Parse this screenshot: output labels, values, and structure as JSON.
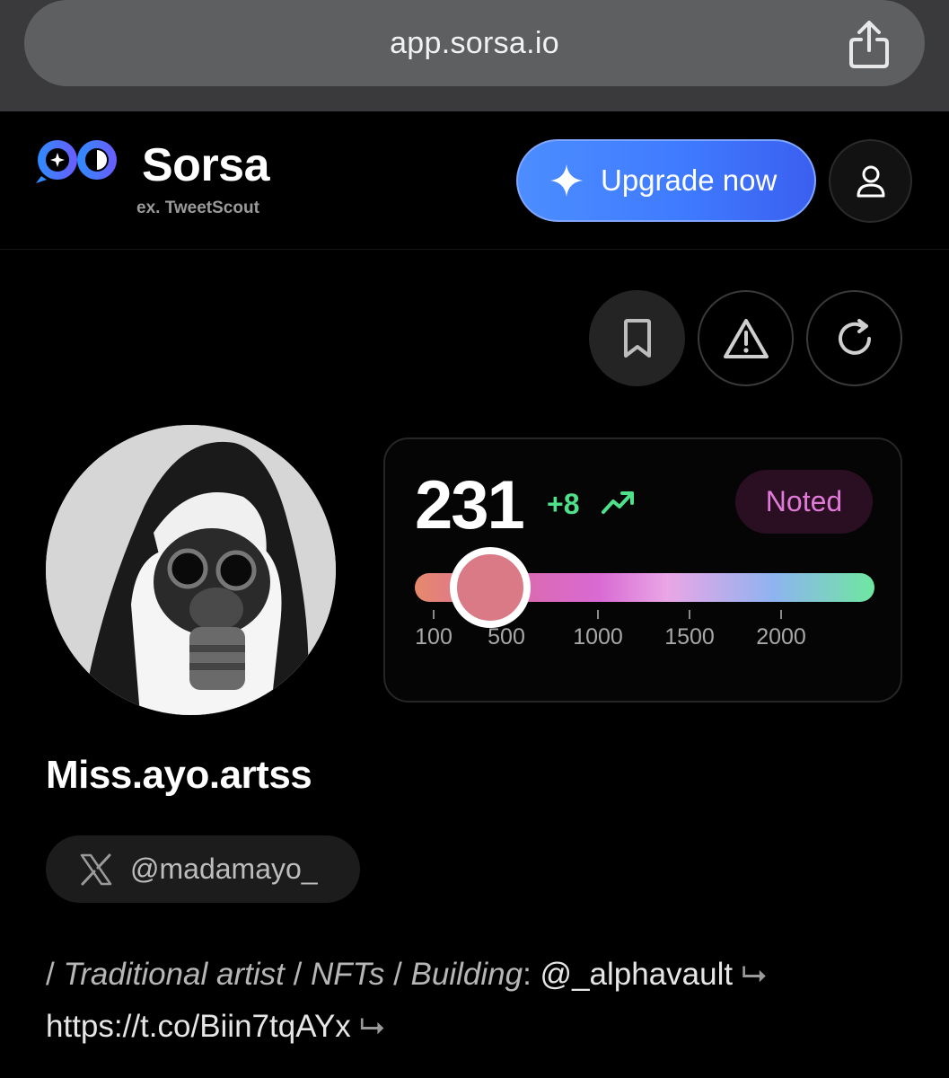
{
  "browser": {
    "url": "app.sorsa.io",
    "share_icon": "share-icon"
  },
  "header": {
    "brand_name": "Sorsa",
    "brand_subtitle": "ex. TweetScout",
    "upgrade_label": "Upgrade now",
    "upgrade_icon": "sparkle-icon",
    "profile_icon": "user-icon",
    "colors": {
      "upgrade_start": "#4c8dff",
      "upgrade_end": "#3b5ff0",
      "logo_blue": "#3f7bff"
    }
  },
  "actions": {
    "bookmark_icon": "bookmark-icon",
    "report_icon": "warning-icon",
    "refresh_icon": "refresh-icon"
  },
  "score": {
    "value": "231",
    "change": "+8",
    "trend_icon": "trending-up-icon",
    "status": "Noted",
    "scale_labels": [
      "100",
      "500",
      "1000",
      "1500",
      "2000"
    ],
    "slider_value": 231,
    "colors": {
      "change": "#4fe08a",
      "status_text": "#e07ad8",
      "status_bg": "#2a0f22",
      "knob": "#d97a86"
    }
  },
  "profile": {
    "display_name": "Miss.ayo.artss",
    "handle": "@madamayo_",
    "handle_icon": "x-logo-icon",
    "avatar_icon": "avatar-image",
    "bio": {
      "sep1": "/ ",
      "role1": "Traditional artist",
      "sep2": " / ",
      "role2": "NFTs",
      "sep3": " / ",
      "role3": "Building",
      "colon": ": ",
      "mention": "@_alphavault",
      "arrow": " ⮡",
      "link": "https://t.co/Biin7tqAYx",
      "arrow2": " ⮡"
    }
  }
}
